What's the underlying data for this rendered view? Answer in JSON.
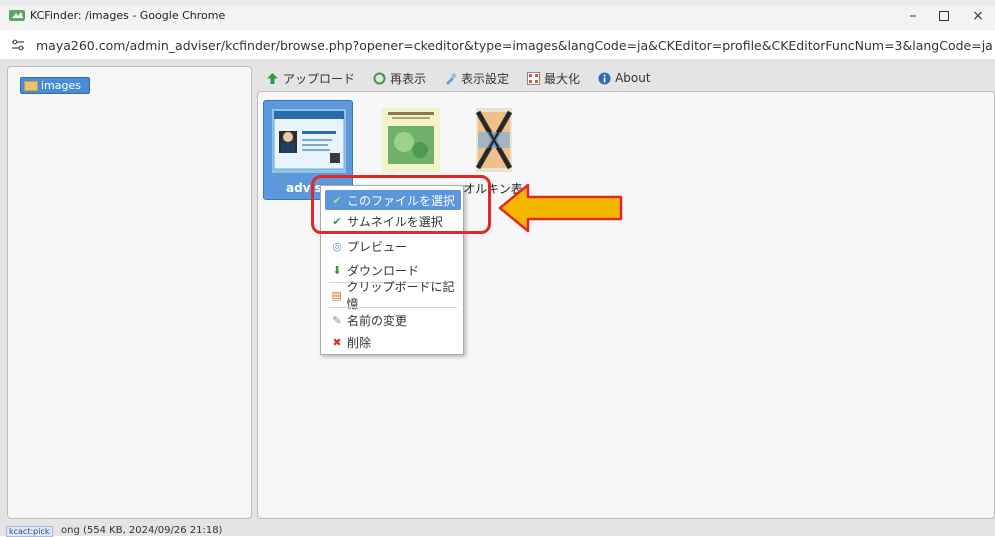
{
  "window": {
    "title": "KCFinder: /images - Google Chrome",
    "minimize_icon": "minimize-icon",
    "maximize_icon": "maximize-icon",
    "close_icon": "close-icon"
  },
  "address": {
    "url": "maya260.com/admin_adviser/kcfinder/browse.php?opener=ckeditor&type=images&langCode=ja&CKEditor=profile&CKEditorFuncNum=3&langCode=ja"
  },
  "sidebar": {
    "folders": [
      {
        "label": "images",
        "icon": "folder-icon"
      }
    ]
  },
  "toolbar": {
    "items": [
      {
        "label": "アップロード",
        "icon": "upload-icon",
        "color": "#2e9a43"
      },
      {
        "label": "再表示",
        "icon": "refresh-icon",
        "color": "#3e9a3e"
      },
      {
        "label": "表示設定",
        "icon": "settings-icon",
        "color": "#6aa0d8"
      },
      {
        "label": "最大化",
        "icon": "maximize-icon",
        "color": "#d9534f"
      },
      {
        "label": "About",
        "icon": "info-icon",
        "color": "#2f6cb3"
      }
    ]
  },
  "files": [
    {
      "name": "advise",
      "selected": true
    },
    {
      "name": "",
      "selected": false
    },
    {
      "name": "オルキン表",
      "selected": false
    }
  ],
  "context_menu": {
    "items": [
      {
        "label": "このファイルを選択",
        "icon": "check-icon",
        "active": true
      },
      {
        "label": "サムネイルを選択",
        "icon": "check-icon",
        "active": false
      },
      {
        "label": "プレビュー",
        "icon": "preview-icon",
        "active": false
      },
      {
        "label": "ダウンロード",
        "icon": "download-icon",
        "active": false
      },
      {
        "label": "クリップボードに記憶",
        "icon": "clipboard-icon",
        "active": false
      },
      {
        "label": "名前の変更",
        "icon": "rename-icon",
        "active": false
      },
      {
        "label": "削除",
        "icon": "delete-icon",
        "active": false
      }
    ]
  },
  "status": {
    "tag": "kcact:pick",
    "text": "ong (554 KB, 2024/09/26 21:18)"
  },
  "colors": {
    "accent": "#5b95da",
    "highlight_border": "#e22727",
    "arrow_fill": "#f5b800",
    "arrow_stroke": "#e22727"
  }
}
